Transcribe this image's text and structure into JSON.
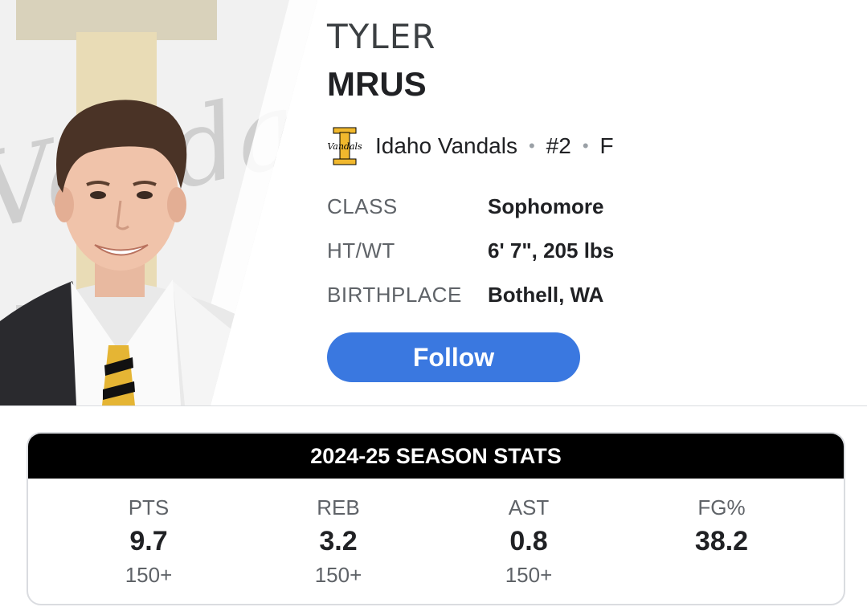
{
  "player": {
    "first_name": "TYLER",
    "last_name": "MRUS"
  },
  "team": {
    "name": "Idaho Vandals",
    "number": "#2",
    "position": "F",
    "logo_letter": "I",
    "logo_text": "Vandals",
    "separator": "•"
  },
  "bio": [
    {
      "label": "CLASS",
      "value": "Sophomore"
    },
    {
      "label": "HT/WT",
      "value": "6' 7\", 205 lbs"
    },
    {
      "label": "BIRTHPLACE",
      "value": "Bothell, WA"
    }
  ],
  "follow_label": "Follow",
  "stats": {
    "title": "2024-25 SEASON STATS",
    "items": [
      {
        "label": "PTS",
        "value": "9.7",
        "rank": "150+"
      },
      {
        "label": "REB",
        "value": "3.2",
        "rank": "150+"
      },
      {
        "label": "AST",
        "value": "0.8",
        "rank": "150+"
      },
      {
        "label": "FG%",
        "value": "38.2",
        "rank": ""
      }
    ]
  },
  "colors": {
    "follow_button": "#3a78e0",
    "stats_header": "#000000",
    "vandals_gold": "#f1b82d",
    "vandals_black": "#000000"
  }
}
